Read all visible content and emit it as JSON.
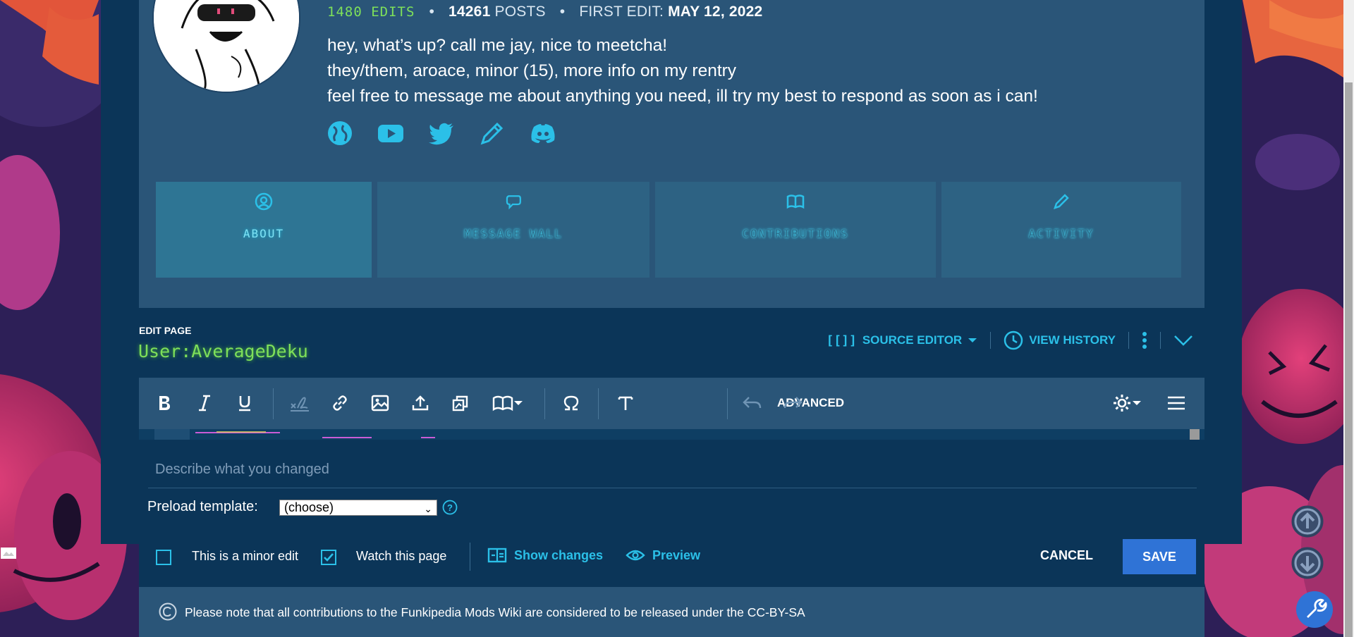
{
  "profile": {
    "edits": "1480 EDITS",
    "posts_count": "14261",
    "posts_label": "POSTS",
    "first_edit_label": "FIRST EDIT:",
    "first_edit_date": "MAY 12, 2022",
    "bio": [
      "hey, what’s up? call me jay, nice to meetcha!",
      "they/them, aroace, minor (15), more info on my rentry",
      "feel free to message me about anything you need, ill try my best to respond as soon as i can!"
    ],
    "social_icons": [
      "globe-icon",
      "youtube-icon",
      "twitter-icon",
      "pencil-icon",
      "discord-icon"
    ],
    "tabs": [
      {
        "label": "ABOUT",
        "icon": "user-circle-icon",
        "active": true
      },
      {
        "label": "MESSAGE WALL",
        "icon": "speech-bubble-icon",
        "active": false
      },
      {
        "label": "CONTRIBUTIONS",
        "icon": "book-icon",
        "active": false
      },
      {
        "label": "ACTIVITY",
        "icon": "pencil-icon",
        "active": false
      }
    ]
  },
  "editor": {
    "edit_page_label": "EDIT PAGE",
    "page_name": "User:AverageDeku",
    "source_editor_label": "SOURCE EDITOR",
    "view_history_label": "VIEW HISTORY",
    "toolbar": {
      "advanced_label": "ADVANCED"
    },
    "summary_placeholder": "Describe what you changed",
    "preload_label": "Preload template:",
    "preload_selected": "(choose)",
    "minor_edit_label": "This is a minor edit",
    "minor_edit_checked": false,
    "watch_label": "Watch this page",
    "watch_checked": true,
    "show_changes_label": "Show changes",
    "preview_label": "Preview",
    "cancel_label": "CANCEL",
    "save_label": "SAVE",
    "license_text": "Please note that all contributions to the Funkipedia Mods Wiki are considered to be released under the CC-BY-SA"
  },
  "colors": {
    "accent": "#2bc0e8",
    "edits_green": "#7ee05a",
    "save_blue": "#2f73d6",
    "panel": "#2a5578",
    "background": "#0b3558"
  }
}
